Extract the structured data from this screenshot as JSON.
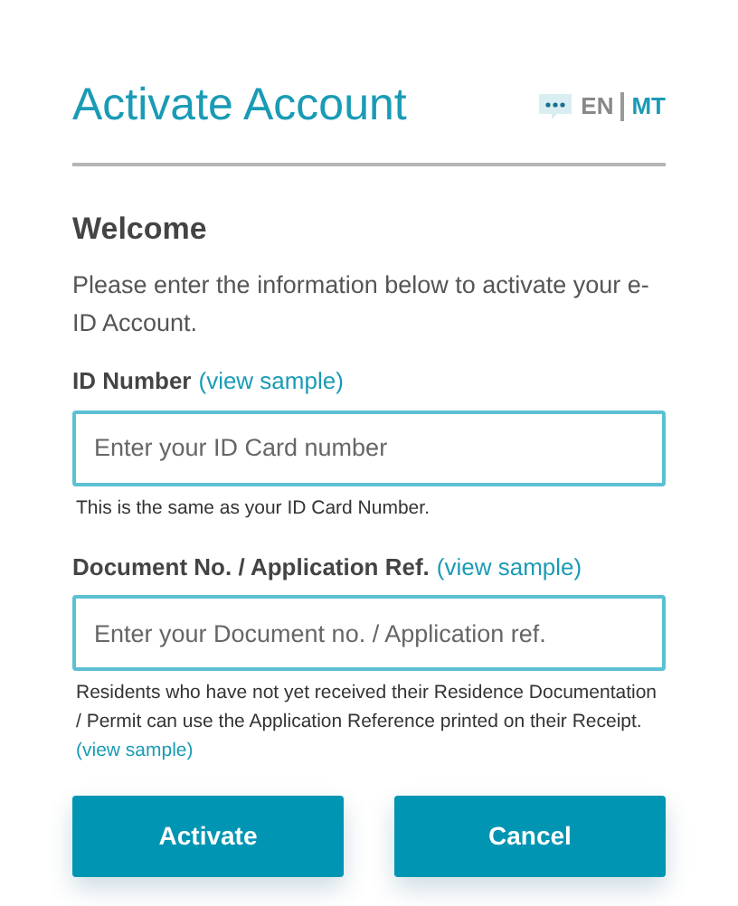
{
  "title": "Activate Account",
  "languages": [
    {
      "label": "EN",
      "selected": true
    },
    {
      "label": "MT",
      "selected": false
    }
  ],
  "heading": "Welcome",
  "intro": "Please enter the information below to activate your e-ID Account.",
  "fields": [
    {
      "label": "ID Number",
      "link_text": "(view sample)",
      "placeholder": "Enter your ID Card number",
      "help": "This is the same as your ID Card Number."
    },
    {
      "label": "Document No. / Application Ref.",
      "link_text": "(view sample)",
      "placeholder": "Enter your Document no. / Application ref.",
      "help": "Residents who have not yet received their Residence Documentation / Permit can use the Application Reference printed on their Receipt.",
      "help_link": "(view sample)"
    }
  ],
  "buttons": [
    "Activate",
    "Cancel"
  ]
}
